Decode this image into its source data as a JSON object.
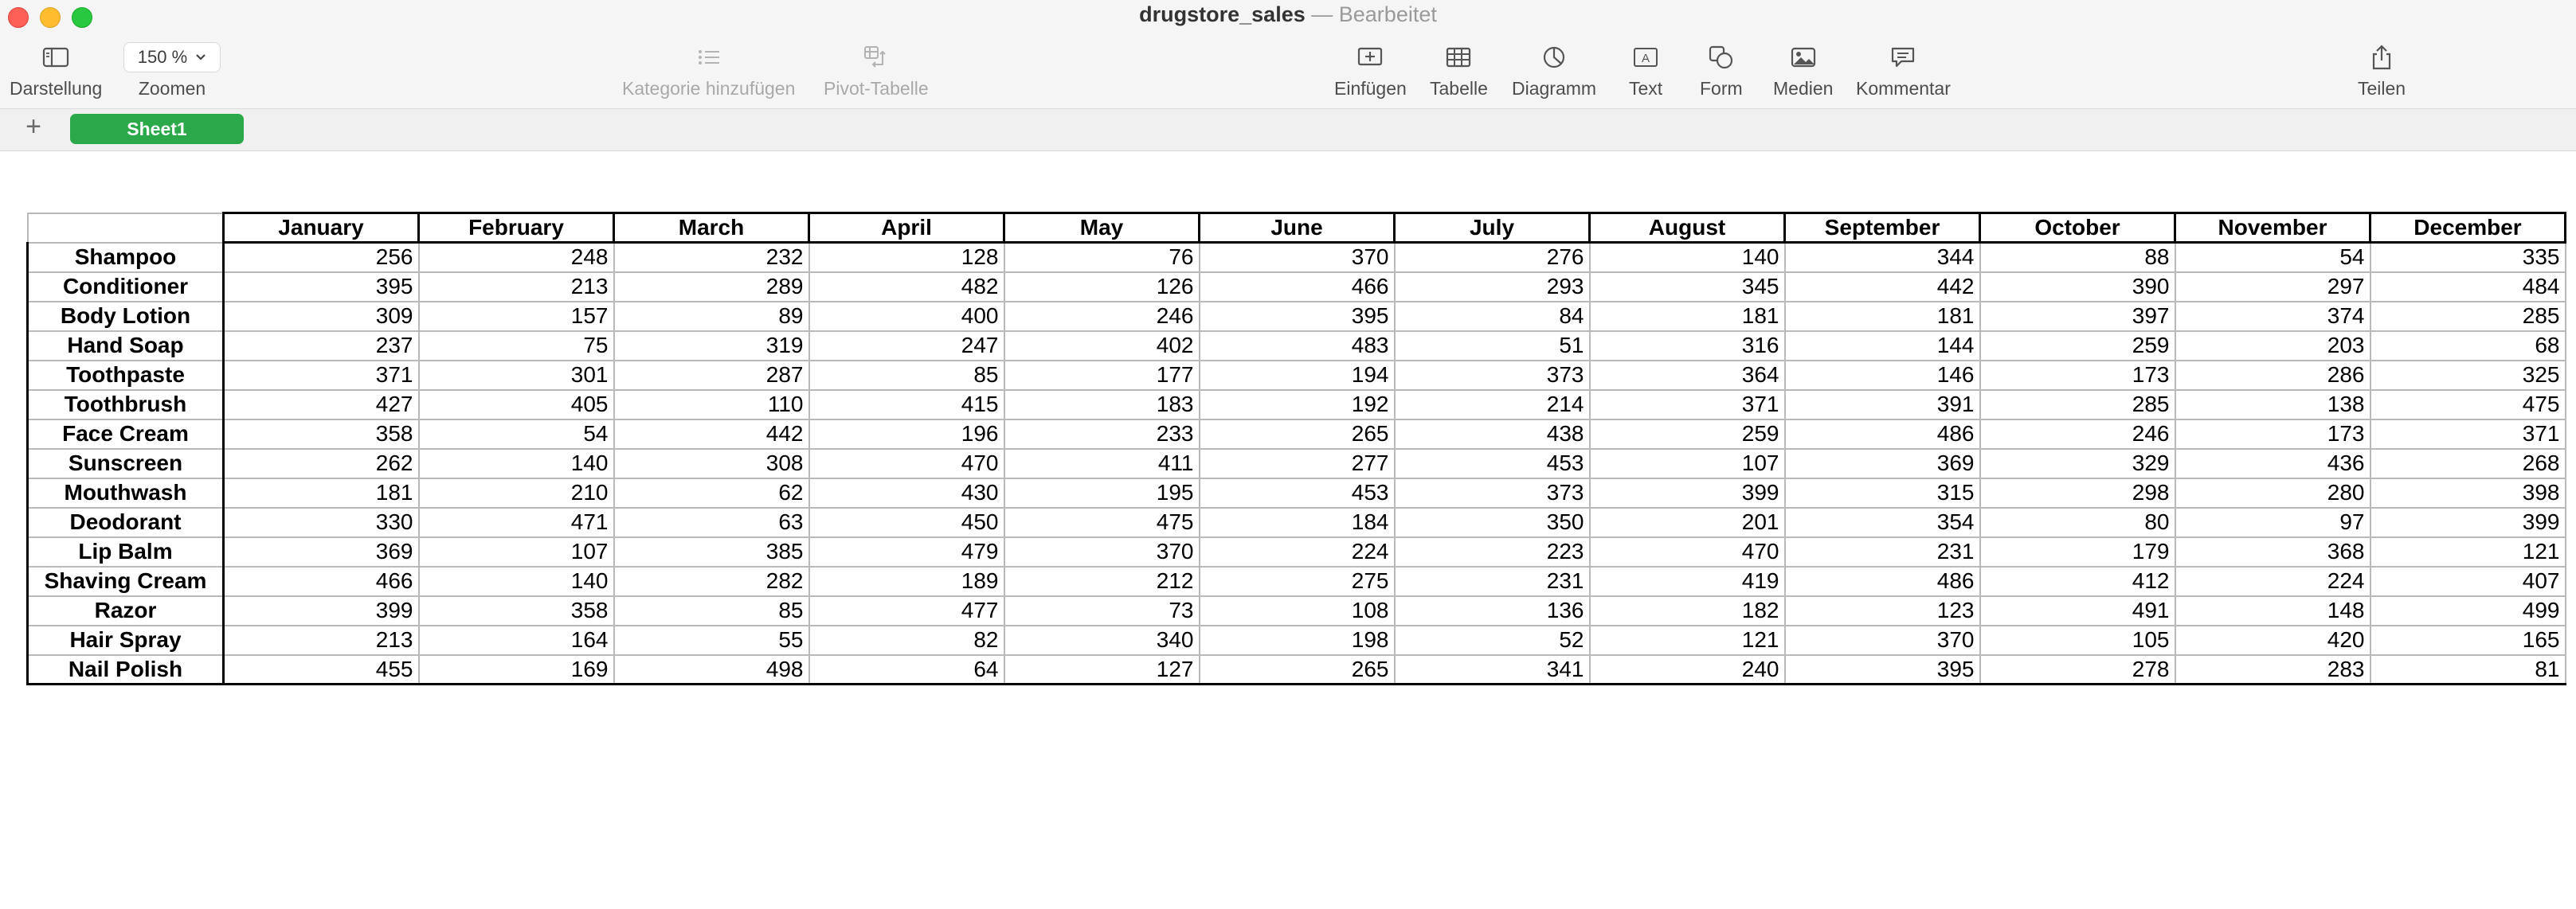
{
  "window": {
    "doc_name": "drugstore_sales",
    "separator": "—",
    "state": "Bearbeitet"
  },
  "toolbar": {
    "view_label": "Darstellung",
    "zoom_value": "150 %",
    "zoom_label": "Zoomen",
    "add_category_label": "Kategorie hinzufügen",
    "pivot_label": "Pivot-Tabelle",
    "insert_label": "Einfügen",
    "table_label": "Tabelle",
    "chart_label": "Diagramm",
    "text_label": "Text",
    "shape_label": "Form",
    "media_label": "Medien",
    "comment_label": "Kommentar",
    "share_label": "Teilen"
  },
  "sheets": {
    "add_symbol": "+",
    "tabs": [
      {
        "label": "Sheet1",
        "active": true
      }
    ]
  },
  "table": {
    "columns": [
      "January",
      "February",
      "March",
      "April",
      "May",
      "June",
      "July",
      "August",
      "September",
      "October",
      "November",
      "December"
    ],
    "rows": [
      {
        "name": "Shampoo",
        "values": [
          "256",
          "248",
          "232",
          "128",
          "76",
          "370",
          "276",
          "140",
          "344",
          "88",
          "54",
          "335"
        ]
      },
      {
        "name": "Conditioner",
        "values": [
          "395",
          "213",
          "289",
          "482",
          "126",
          "466",
          "293",
          "345",
          "442",
          "390",
          "297",
          "484"
        ]
      },
      {
        "name": "Body Lotion",
        "values": [
          "309",
          "157",
          "89",
          "400",
          "246",
          "395",
          "84",
          "181",
          "181",
          "397",
          "374",
          "285"
        ]
      },
      {
        "name": "Hand Soap",
        "values": [
          "237",
          "75",
          "319",
          "247",
          "402",
          "483",
          "51",
          "316",
          "144",
          "259",
          "203",
          "68"
        ]
      },
      {
        "name": "Toothpaste",
        "values": [
          "371",
          "301",
          "287",
          "85",
          "177",
          "194",
          "373",
          "364",
          "146",
          "173",
          "286",
          "325"
        ]
      },
      {
        "name": "Toothbrush",
        "values": [
          "427",
          "405",
          "110",
          "415",
          "183",
          "192",
          "214",
          "371",
          "391",
          "285",
          "138",
          "475"
        ]
      },
      {
        "name": "Face Cream",
        "values": [
          "358",
          "54",
          "442",
          "196",
          "233",
          "265",
          "438",
          "259",
          "486",
          "246",
          "173",
          "371"
        ]
      },
      {
        "name": "Sunscreen",
        "values": [
          "262",
          "140",
          "308",
          "470",
          "411",
          "277",
          "453",
          "107",
          "369",
          "329",
          "436",
          "268"
        ]
      },
      {
        "name": "Mouthwash",
        "values": [
          "181",
          "210",
          "62",
          "430",
          "195",
          "453",
          "373",
          "399",
          "315",
          "298",
          "280",
          "398"
        ]
      },
      {
        "name": "Deodorant",
        "values": [
          "330",
          "471",
          "63",
          "450",
          "475",
          "184",
          "350",
          "201",
          "354",
          "80",
          "97",
          "399"
        ]
      },
      {
        "name": "Lip Balm",
        "values": [
          "369",
          "107",
          "385",
          "479",
          "370",
          "224",
          "223",
          "470",
          "231",
          "179",
          "368",
          "121"
        ]
      },
      {
        "name": "Shaving Cream",
        "values": [
          "466",
          "140",
          "282",
          "189",
          "212",
          "275",
          "231",
          "419",
          "486",
          "412",
          "224",
          "407"
        ]
      },
      {
        "name": "Razor",
        "values": [
          "399",
          "358",
          "85",
          "477",
          "73",
          "108",
          "136",
          "182",
          "123",
          "491",
          "148",
          "499"
        ]
      },
      {
        "name": "Hair Spray",
        "values": [
          "213",
          "164",
          "55",
          "82",
          "340",
          "198",
          "52",
          "121",
          "370",
          "105",
          "420",
          "165"
        ]
      },
      {
        "name": "Nail Polish",
        "values": [
          "455",
          "169",
          "498",
          "64",
          "127",
          "265",
          "341",
          "240",
          "395",
          "278",
          "283",
          "81"
        ]
      }
    ]
  },
  "colors": {
    "sheet_tab": "#2aa84a",
    "toolbar_bg": "#f5f5f5",
    "close": "#fe5f57",
    "minimize": "#febc2e",
    "maximize": "#28c840"
  }
}
